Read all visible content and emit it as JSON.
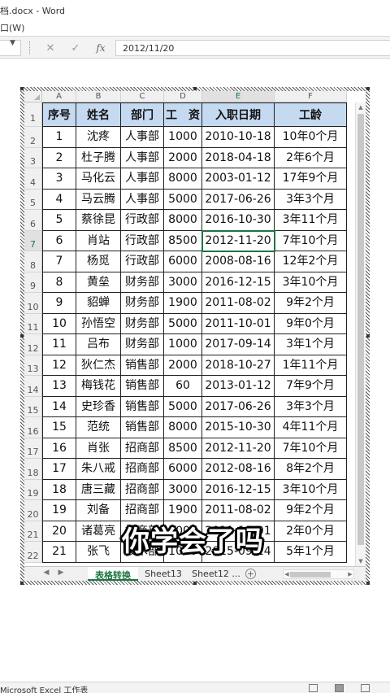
{
  "window": {
    "title": "档.docx - Word",
    "menu_fragment": "口(W)"
  },
  "formula_bar": {
    "value": "2012/11/20",
    "cancel_icon": "x-icon",
    "confirm_icon": "check-icon",
    "function_label": "fx"
  },
  "sheet": {
    "column_letters": [
      "A",
      "B",
      "C",
      "D",
      "E",
      "F"
    ],
    "row_numbers": [
      "1",
      "2",
      "3",
      "4",
      "5",
      "6",
      "7",
      "8",
      "9",
      "10",
      "11",
      "12",
      "13",
      "14",
      "15",
      "16",
      "17",
      "18",
      "19",
      "20",
      "21",
      "22"
    ],
    "headers": [
      "序号",
      "姓名",
      "部门",
      "工　资",
      "入职日期",
      "工龄"
    ],
    "rows": [
      [
        "1",
        "沈疼",
        "人事部",
        "1000",
        "2010-10-18",
        "10年0个月"
      ],
      [
        "2",
        "杜子腾",
        "人事部",
        "2000",
        "2018-04-18",
        "2年6个月"
      ],
      [
        "3",
        "马化云",
        "人事部",
        "8000",
        "2003-01-12",
        "17年9个月"
      ],
      [
        "4",
        "马云腾",
        "人事部",
        "5000",
        "2017-06-26",
        "3年3个月"
      ],
      [
        "5",
        "蔡徐昆",
        "行政部",
        "8000",
        "2016-10-30",
        "3年11个月"
      ],
      [
        "6",
        "肖站",
        "行政部",
        "8500",
        "2012-11-20",
        "7年10个月"
      ],
      [
        "7",
        "杨觅",
        "行政部",
        "6000",
        "2008-08-16",
        "12年2个月"
      ],
      [
        "8",
        "黄垒",
        "财务部",
        "3000",
        "2016-12-15",
        "3年10个月"
      ],
      [
        "9",
        "貂蝉",
        "财务部",
        "1900",
        "2011-08-02",
        "9年2个月"
      ],
      [
        "10",
        "孙悟空",
        "财务部",
        "5000",
        "2011-10-01",
        "9年0个月"
      ],
      [
        "11",
        "吕布",
        "财务部",
        "1000",
        "2017-09-14",
        "3年1个月"
      ],
      [
        "12",
        "狄仁杰",
        "销售部",
        "2000",
        "2018-10-27",
        "1年11个月"
      ],
      [
        "13",
        "梅钱花",
        "销售部",
        "60",
        "2013-01-12",
        "7年9个月"
      ],
      [
        "14",
        "史珍香",
        "销售部",
        "5000",
        "2017-06-26",
        "3年3个月"
      ],
      [
        "15",
        "范统",
        "销售部",
        "8000",
        "2015-10-30",
        "4年11个月"
      ],
      [
        "16",
        "肖张",
        "招商部",
        "8500",
        "2012-11-20",
        "7年10个月"
      ],
      [
        "17",
        "朱八戒",
        "招商部",
        "6000",
        "2012-08-16",
        "8年2个月"
      ],
      [
        "18",
        "唐三藏",
        "招商部",
        "3000",
        "2016-12-15",
        "3年10个月"
      ],
      [
        "19",
        "刘备",
        "招商部",
        "1900",
        "2011-08-02",
        "9年2个月"
      ],
      [
        "20",
        "诸葛亮",
        "招商部",
        "5000",
        "2011-10-01",
        "2年0个月"
      ],
      [
        "21",
        "张飞",
        "技术部",
        "1000",
        "2015-09-14",
        "5年1个月"
      ]
    ],
    "selected_row": 7,
    "selected_col": "E"
  },
  "tabs": [
    {
      "label": "表格转换",
      "active": true
    },
    {
      "label": "Sheet13",
      "active": false
    },
    {
      "label": "Sheet12 ...",
      "active": false
    }
  ],
  "overlay_caption": "你学会了吗",
  "status": {
    "text": "Microsoft Excel 工作表"
  },
  "colors": {
    "header_fill": "#c5d9f1",
    "excel_green": "#217346"
  }
}
